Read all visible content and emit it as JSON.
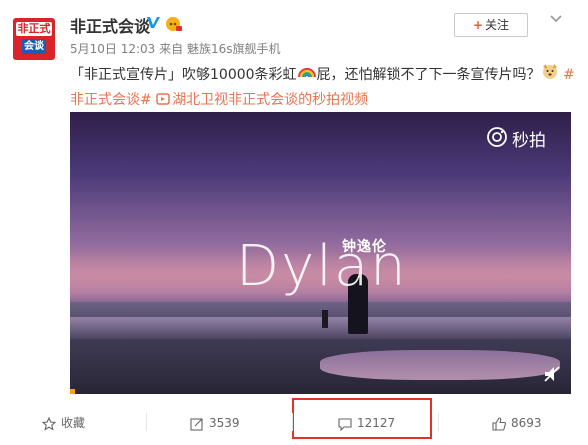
{
  "account": {
    "name": "非正式会谈",
    "avatar_top": "非正式",
    "avatar_bottom": "会谈"
  },
  "post": {
    "date": "5月10日 12:03",
    "source_prefix": "来自",
    "source": "魅族16s旗舰手机",
    "text_part1": "「非正式宣传片」吹够10000条彩虹",
    "text_part2": "屁，还怕解锁不了下一条宣传片吗？",
    "hashtag_open": "#",
    "hashtag": "非正式会谈#",
    "link_text": "湖北卫视非正式会谈的秒拍视频"
  },
  "follow_button": {
    "label": "关注",
    "plus": "+"
  },
  "video": {
    "title_en": "Dylan",
    "title_zh": "钟逸伦",
    "watermark": "秒拍",
    "progress_percent": 1
  },
  "actions": {
    "favorite_label": "收藏",
    "repost_count": "3539",
    "comment_count": "12127",
    "like_count": "8693"
  },
  "colors": {
    "accent": "#eb7350",
    "highlight": "#e5302a",
    "verified": "#1596e6"
  }
}
